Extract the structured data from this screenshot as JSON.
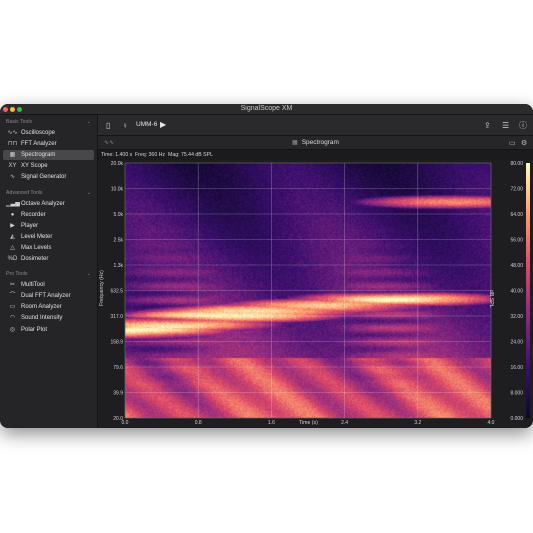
{
  "window": {
    "title": "SignalScope XM"
  },
  "sidebar": {
    "sections": [
      {
        "title": "Basic Tools",
        "items": [
          {
            "label": "Oscilloscope",
            "icon": "oscilloscope-icon",
            "glyph": "∿∿"
          },
          {
            "label": "FFT Analyzer",
            "icon": "fft-icon",
            "glyph": "⊓⊓"
          },
          {
            "label": "Spectrogram",
            "icon": "spectrogram-icon",
            "glyph": "▦",
            "active": true
          },
          {
            "label": "XY Scope",
            "icon": "xy-scope-icon",
            "glyph": "XY"
          },
          {
            "label": "Signal Generator",
            "icon": "signal-generator-icon",
            "glyph": "∿"
          }
        ]
      },
      {
        "title": "Advanced Tools",
        "items": [
          {
            "label": "Octave Analyzer",
            "icon": "octave-analyzer-icon",
            "glyph": "▁▃▅"
          },
          {
            "label": "Recorder",
            "icon": "recorder-icon",
            "glyph": "●"
          },
          {
            "label": "Player",
            "icon": "player-icon",
            "glyph": "▶"
          },
          {
            "label": "Level Meter",
            "icon": "level-meter-icon",
            "glyph": "◭"
          },
          {
            "label": "Max Levels",
            "icon": "max-levels-icon",
            "glyph": "△"
          },
          {
            "label": "Dosimeter",
            "icon": "dosimeter-icon",
            "glyph": "%D"
          }
        ]
      },
      {
        "title": "Pro Tools",
        "items": [
          {
            "label": "MultiTool",
            "icon": "multitool-icon",
            "glyph": "✂"
          },
          {
            "label": "Dual FFT Analyzer",
            "icon": "dual-fft-icon",
            "glyph": "⌒"
          },
          {
            "label": "Room Analyzer",
            "icon": "room-analyzer-icon",
            "glyph": "▭"
          },
          {
            "label": "Sound Intensity",
            "icon": "sound-intensity-icon",
            "glyph": "◠"
          },
          {
            "label": "Polar Plot",
            "icon": "polar-plot-icon",
            "glyph": "◎"
          }
        ]
      }
    ]
  },
  "toolbar": {
    "device": "UMM-6"
  },
  "subbar": {
    "title": "Spectrogram"
  },
  "readout": {
    "time": "Time: 1.400 s",
    "freq": "Freq: 360 Hz",
    "mag": "Mag: 75.44 dB SPL"
  },
  "colors": {
    "accent": "#ffffff",
    "window_bg": "#1f1f21",
    "sidebar_bg": "#252527"
  },
  "chart_data": {
    "type": "heatmap",
    "xlabel": "Time (s)",
    "ylabel": "Frequency (Hz)",
    "x_ticks": [
      "0.0",
      "0.8",
      "1.6",
      "2.4",
      "3.2",
      "4.0"
    ],
    "xlim": [
      0,
      4.0
    ],
    "y_scale": "log",
    "y_ticks": [
      "20.0k",
      "10.0k",
      "5.0k",
      "2.5k",
      "1.3k",
      "632.5",
      "317.0",
      "158.9",
      "79.6",
      "39.9",
      "20.0"
    ],
    "ylim": [
      20,
      20000
    ],
    "colorbar_label": "dB SPL",
    "colorbar_ticks": [
      "80.00",
      "72.00",
      "64.00",
      "56.00",
      "48.00",
      "40.00",
      "32.00",
      "24.00",
      "16.00",
      "8.000",
      "0.000"
    ],
    "colorbar_range": [
      0,
      80
    ],
    "colormap": [
      "#0d0829",
      "#3b0f70",
      "#8c2981",
      "#de4968",
      "#fe9f6d",
      "#fcfdbf"
    ],
    "features": [
      {
        "time": 0.0,
        "freq": 210,
        "level": 78
      },
      {
        "time": 0.5,
        "freq": 250,
        "level": 74
      },
      {
        "time": 1.2,
        "freq": 320,
        "level": 78
      },
      {
        "time": 1.4,
        "freq": 360,
        "level": 75
      },
      {
        "time": 2.2,
        "freq": 420,
        "level": 72
      },
      {
        "time": 3.0,
        "freq": 500,
        "level": 74
      },
      {
        "time": 3.6,
        "freq": 7000,
        "level": 60
      }
    ]
  }
}
